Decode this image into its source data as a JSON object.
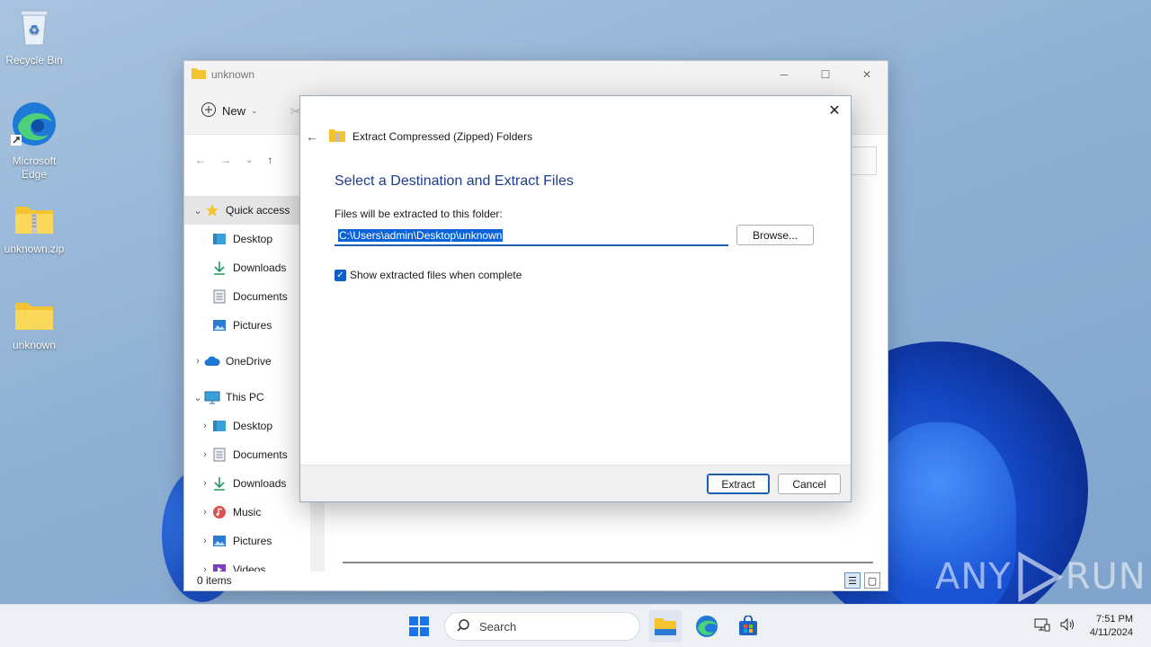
{
  "desktop": {
    "icons": [
      {
        "label": "Recycle Bin"
      },
      {
        "label": "Microsoft Edge"
      },
      {
        "label": "unknown.zip"
      },
      {
        "label": "unknown"
      }
    ]
  },
  "explorer": {
    "title": "unknown",
    "toolbar": {
      "new_label": "New"
    },
    "sidebar": [
      {
        "label": "Quick access",
        "icon": "star-icon",
        "expanded": true
      },
      {
        "label": "Desktop",
        "icon": "desktop-icon"
      },
      {
        "label": "Downloads",
        "icon": "download-icon"
      },
      {
        "label": "Documents",
        "icon": "document-icon"
      },
      {
        "label": "Pictures",
        "icon": "picture-icon"
      },
      {
        "label": "OneDrive",
        "icon": "cloud-icon"
      },
      {
        "label": "This PC",
        "icon": "computer-icon",
        "expanded": true
      },
      {
        "label": "Desktop",
        "icon": "desktop-icon"
      },
      {
        "label": "Documents",
        "icon": "document-icon"
      },
      {
        "label": "Downloads",
        "icon": "download-icon"
      },
      {
        "label": "Music",
        "icon": "music-icon"
      },
      {
        "label": "Pictures",
        "icon": "picture-icon"
      },
      {
        "label": "Videos",
        "icon": "video-icon"
      }
    ],
    "status": "0 items"
  },
  "dialog": {
    "header": "Extract Compressed (Zipped) Folders",
    "heading": "Select a Destination and Extract Files",
    "field_label": "Files will be extracted to this folder:",
    "path_value": "C:\\Users\\admin\\Desktop\\unknown",
    "browse_label": "Browse...",
    "checkbox_label": "Show extracted files when complete",
    "checkbox_checked": true,
    "extract_label": "Extract",
    "cancel_label": "Cancel"
  },
  "taskbar": {
    "search_placeholder": "Search",
    "time": "7:51 PM",
    "date": "4/11/2024"
  },
  "watermark": {
    "left": "ANY",
    "right": "RUN"
  },
  "colors": {
    "accent": "#0f5fc7",
    "heading": "#1e3c8f",
    "folder": "#f4c430"
  }
}
